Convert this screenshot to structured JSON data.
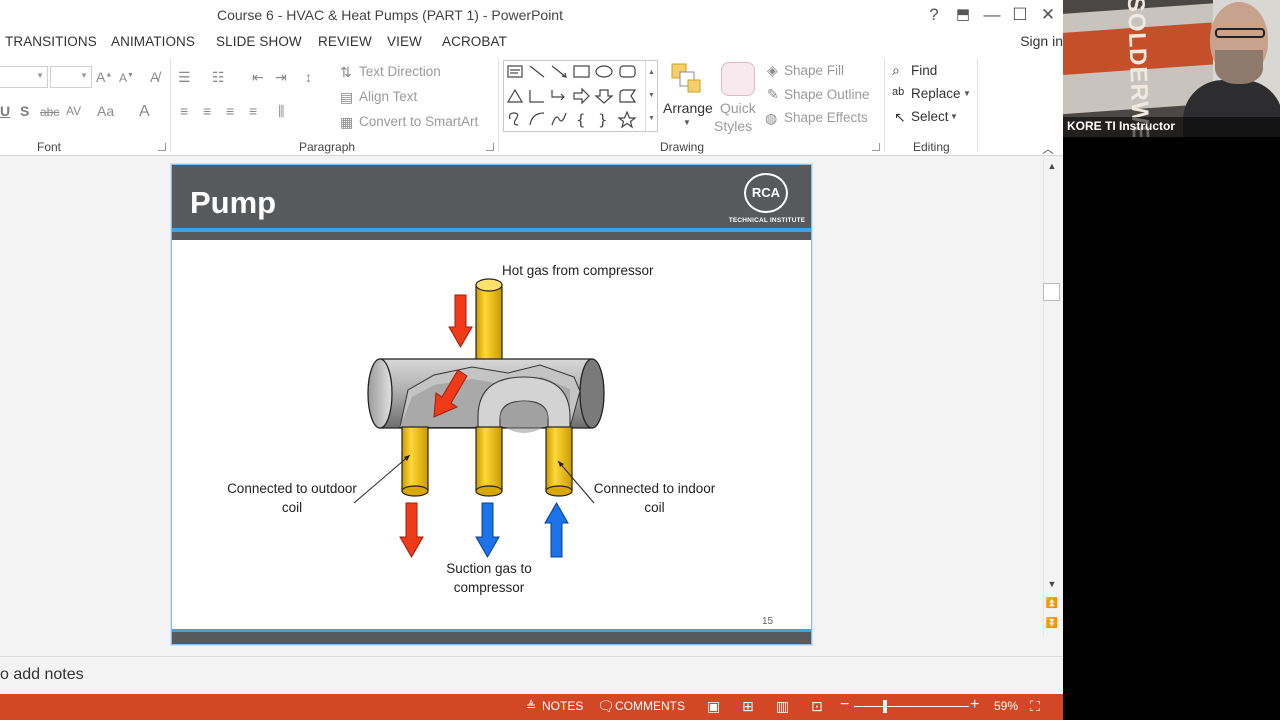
{
  "window": {
    "title": "Course 6 - HVAC & Heat Pumps (PART 1) - PowerPoint",
    "help": "?",
    "restore_ribbon": "⬒",
    "minimize": "—",
    "maximize": "☐",
    "close": "✕"
  },
  "tabs": [
    "TRANSITIONS",
    "ANIMATIONS",
    "SLIDE SHOW",
    "REVIEW",
    "VIEW",
    "ACROBAT"
  ],
  "signin": "Sign in",
  "ribbon": {
    "font": {
      "label": "Font",
      "row2": [
        "U",
        "S",
        "abc",
        "AV",
        "Aa",
        "A"
      ]
    },
    "paragraph": {
      "label": "Paragraph",
      "text_direction": "Text Direction",
      "align_text": "Align Text",
      "convert_smartart": "Convert to SmartArt"
    },
    "drawing": {
      "label": "Drawing",
      "arrange": "Arrange",
      "quick_styles_1": "Quick",
      "quick_styles_2": "Styles",
      "shape_fill": "Shape Fill",
      "shape_outline": "Shape Outline",
      "shape_effects": "Shape Effects"
    },
    "editing": {
      "label": "Editing",
      "find": "Find",
      "replace": "Replace",
      "select": "Select"
    }
  },
  "slide": {
    "title": "Pump",
    "logo_main": "RCA",
    "logo_sub": "TECHNICAL INSTITUTE",
    "label_top": "Hot gas from compressor",
    "label_left_1": "Connected to outdoor",
    "label_left_2": "coil",
    "label_right_1": "Connected to indoor",
    "label_right_2": "coil",
    "label_bottom_1": "Suction gas to",
    "label_bottom_2": "compressor",
    "page_number": "15",
    "colors": {
      "header": "#58595b",
      "accent_blue": "#3fa3e2",
      "pipe_yellow": "#f2c200",
      "arrow_red": "#f03a17",
      "arrow_blue": "#1a73e8",
      "body_gray": "#9a9a9a"
    }
  },
  "notes": {
    "placeholder": "o add notes"
  },
  "statusbar": {
    "notes": "NOTES",
    "comments": "COMMENTS",
    "zoom": "59%",
    "minus": "−",
    "plus": "+"
  },
  "webcam": {
    "name": "KORE TI Instructor",
    "banner_text": "SOLDERWELD"
  }
}
